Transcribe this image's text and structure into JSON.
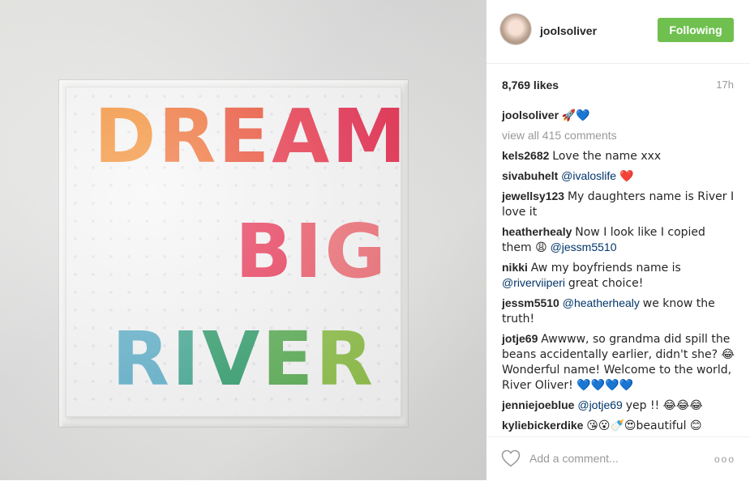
{
  "photo": {
    "lines": [
      {
        "text": "DREAM",
        "colors": [
          "#f58a2a",
          "#f06a2c",
          "#ec4b30",
          "#e93146",
          "#e5284a"
        ]
      },
      {
        "text": "BIG",
        "colors": [
          "#ea3858",
          "#eb5564",
          "#ee6c74"
        ]
      },
      {
        "text": "RIVER",
        "colors": [
          "#5baec8",
          "#3fa68f",
          "#2e9c6a",
          "#56ab50",
          "#8bbd44"
        ]
      }
    ]
  },
  "header": {
    "username": "joolsoliver",
    "follow_label": "Following",
    "follow_color": "#70c050"
  },
  "meta": {
    "likes": "8,769 likes",
    "time": "17h"
  },
  "caption": {
    "user": "joolsoliver",
    "text": "🚀💙"
  },
  "view_all": "view all 415 comments",
  "comments": [
    {
      "user": "kels2682",
      "text": "Love the name xxx"
    },
    {
      "user": "sivabuhelt",
      "mention": "@ivaloslife",
      "after": "❤️"
    },
    {
      "user": "jewellsy123",
      "text": "My daughters name is River I love it"
    },
    {
      "user": "heatherhealy",
      "text": "Now I look like I copied them 😩",
      "mention": "@jessm5510"
    },
    {
      "user": "nikki",
      "text": "Aw my boyfriends name is",
      "mention": "@riverviiperi",
      "after": "great choice!"
    },
    {
      "user": "jessm5510",
      "mention": "@heatherhealy",
      "after": "we know the truth!"
    },
    {
      "user": "jotje69",
      "text": "Awwww, so grandma did spill the beans accidentally earlier, didn't she? 😂 Wonderful name! Welcome to the world, River Oliver! 💙💙💙💙"
    },
    {
      "user": "jenniejoebluе",
      "mention": "@jotje69",
      "after": "yep !! 😂😂😂"
    },
    {
      "user": "kyliebickerdike",
      "text": "😘😮🍼😍beautiful 😊"
    }
  ],
  "footer": {
    "placeholder": "Add a comment...",
    "more": "ooo",
    "icons": [
      "heart-icon",
      "more-options-icon"
    ]
  }
}
